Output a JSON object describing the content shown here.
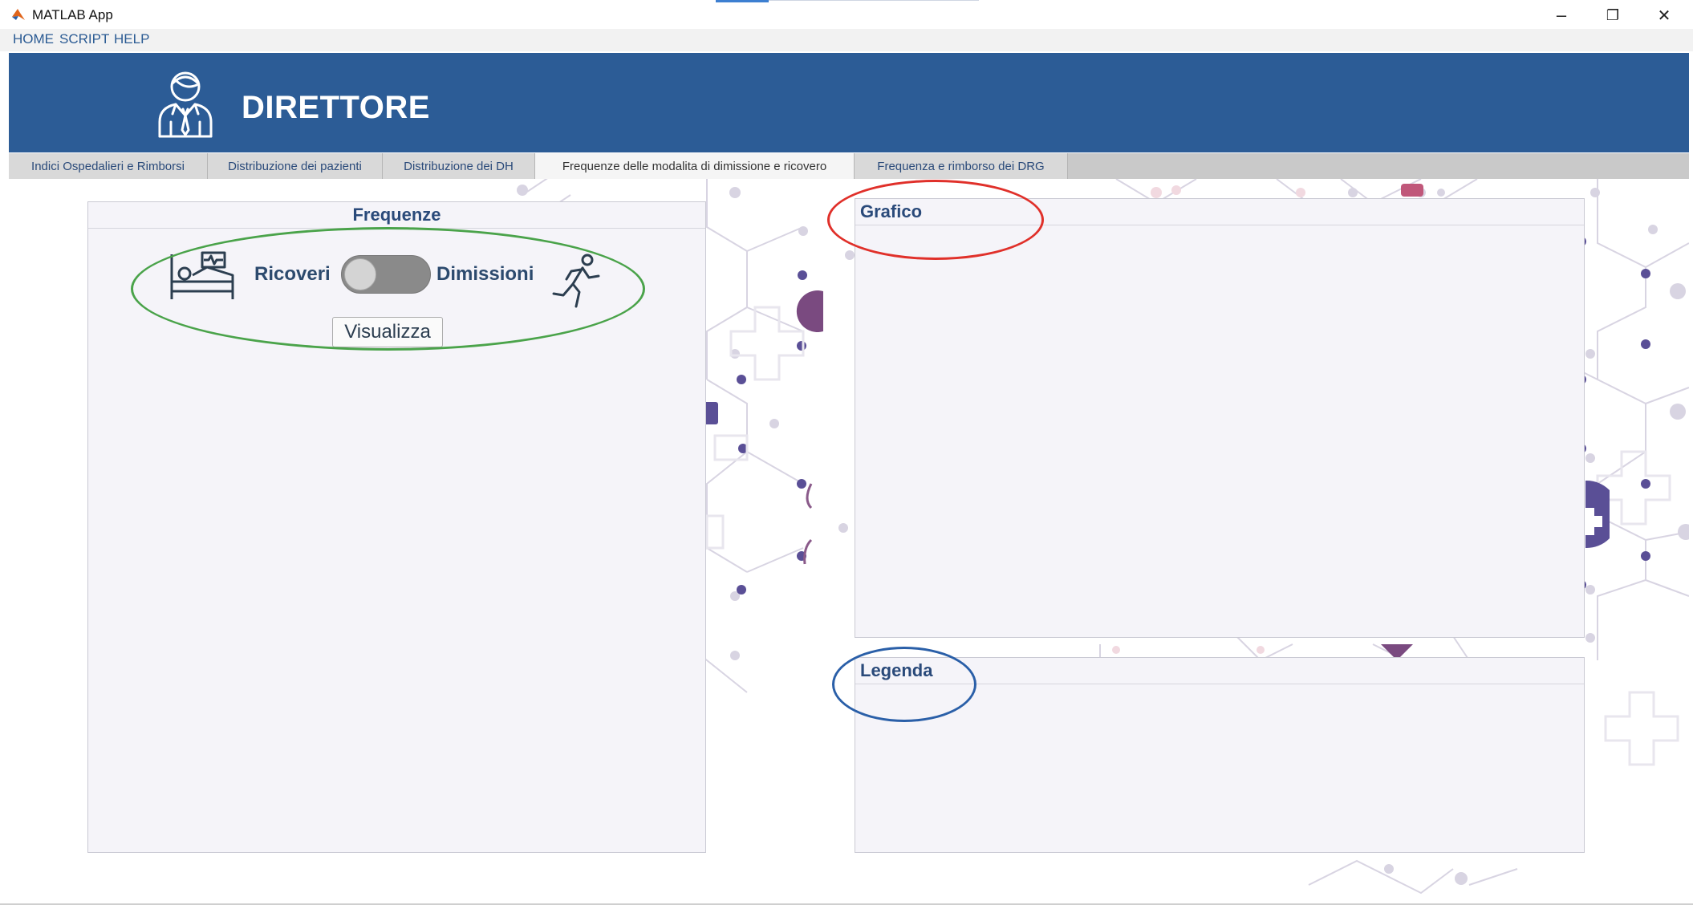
{
  "window": {
    "title": "MATLAB App",
    "controls": {
      "minimize": "–",
      "restore": "❐",
      "close": "✕"
    }
  },
  "menu": [
    "HOME",
    "SCRIPT",
    "HELP"
  ],
  "banner": {
    "title": "DIRETTORE",
    "icon": "businessman-icon",
    "color": "#2c5c96"
  },
  "tabs": [
    {
      "label": "Indici Ospedalieri e Rimborsi",
      "active": false
    },
    {
      "label": "Distribuzione dei pazienti",
      "active": false
    },
    {
      "label": "Distribuzione dei DH",
      "active": false
    },
    {
      "label": "Frequenze delle modalita di dimissione e ricovero",
      "active": true
    },
    {
      "label": "Frequenza e rimborso dei DRG",
      "active": false
    }
  ],
  "frequenze_panel": {
    "title": "Frequenze",
    "toggle": {
      "left_label": "Ricoveri",
      "right_label": "Dimissioni",
      "state": "Ricoveri"
    },
    "button_label": "Visualizza",
    "icons": {
      "left": "hospital-bed-icon",
      "right": "running-person-icon"
    }
  },
  "grafico_panel": {
    "title": "Grafico"
  },
  "legenda_panel": {
    "title": "Legenda"
  },
  "annotations": {
    "green": "#4aa34a",
    "red": "#e0302a",
    "blue": "#2a5fa8"
  }
}
